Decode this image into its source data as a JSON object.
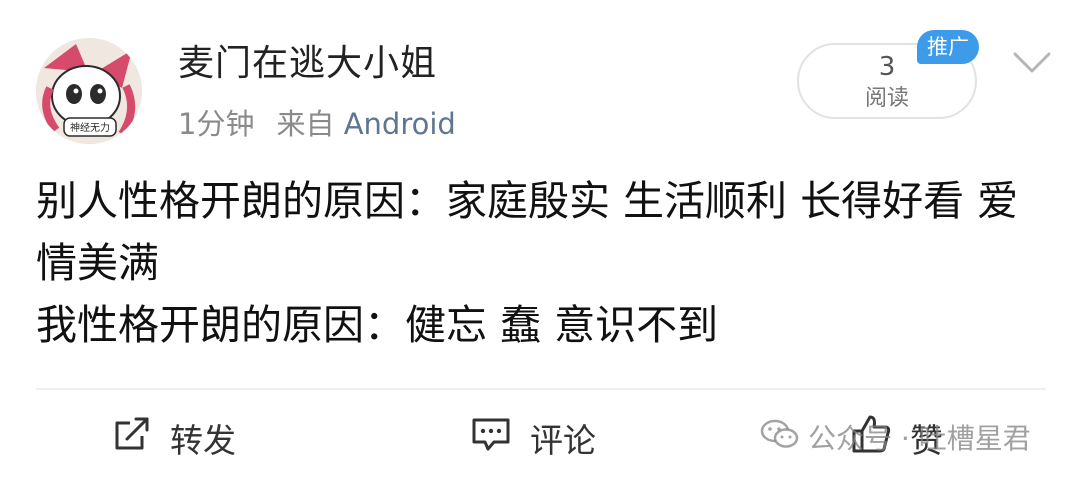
{
  "post": {
    "username": "麦门在逃大小姐",
    "time": "1分钟",
    "source_prefix": "来自",
    "source": "Android",
    "read_count": "3",
    "read_label": "阅读",
    "badge": "推广",
    "lines": [
      "别人性格开朗的原因：家庭殷实 生活顺利 长得好看 爱情美满",
      "我性格开朗的原因：健忘 蠢 意识不到"
    ]
  },
  "avatar": {
    "badge_text": "神经无力"
  },
  "actions": {
    "repost": "转发",
    "comment": "评论",
    "like": "赞"
  },
  "watermark": {
    "text": "公众号 · 吐槽星君"
  },
  "colors": {
    "link": "#5f7690",
    "badge": "#3d9be9",
    "muted": "#8a8a8a"
  }
}
